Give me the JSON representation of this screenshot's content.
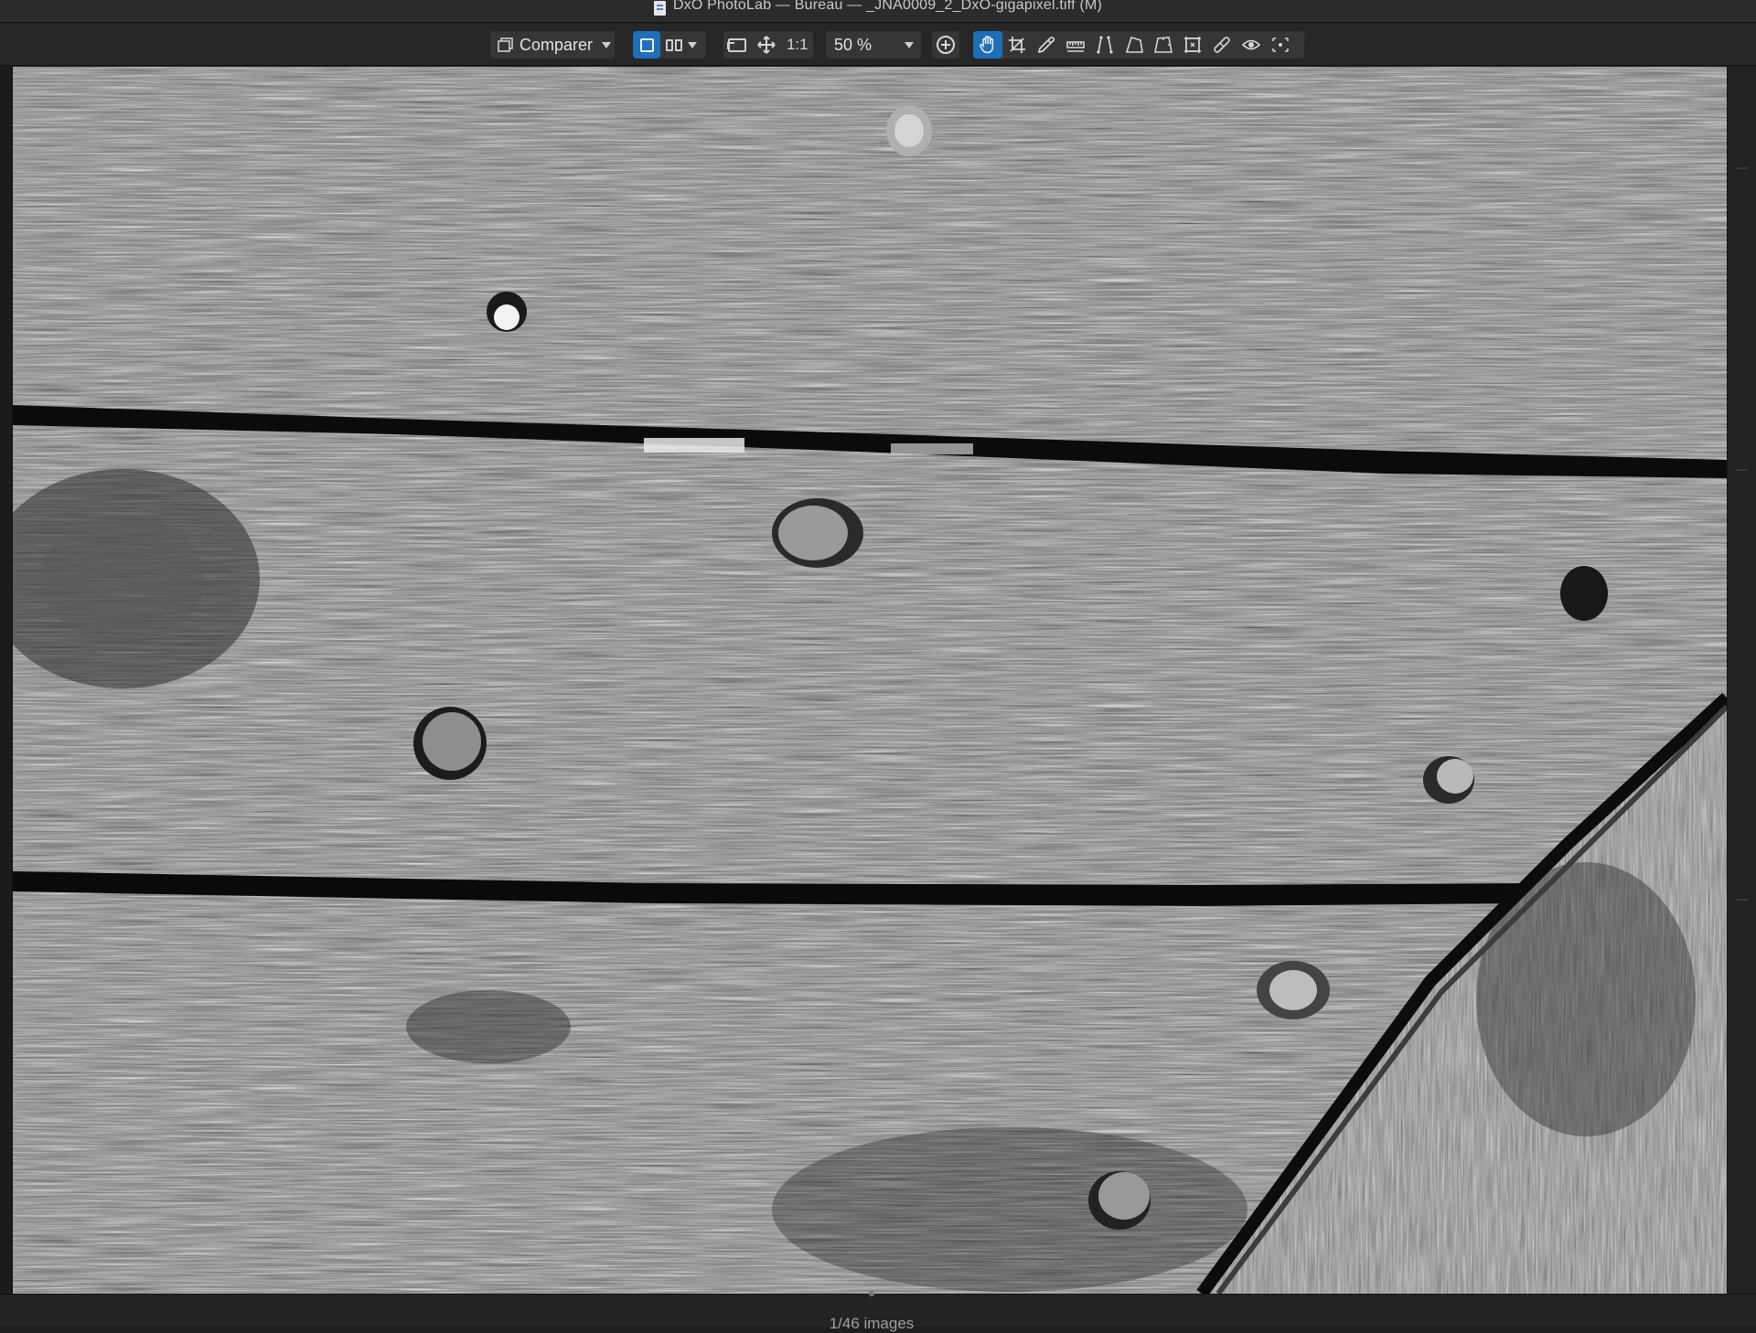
{
  "window": {
    "title": "DxO PhotoLab — Bureau — _JNA0009_2_DxO-gigapixel.tiff (M)"
  },
  "toolbar": {
    "compare_label": "Comparer",
    "one_to_one_label": "1:1",
    "zoom_value": "50 %",
    "tools": [
      {
        "name": "hand-tool",
        "active": true
      },
      {
        "name": "crop-tool",
        "active": false
      },
      {
        "name": "white-balance-picker",
        "active": false
      },
      {
        "name": "horizon-tool",
        "active": false
      },
      {
        "name": "perspective-vertical-tool",
        "active": false
      },
      {
        "name": "perspective-rect-tool",
        "active": false
      },
      {
        "name": "perspective-8point-tool",
        "active": false
      },
      {
        "name": "grid-tool",
        "active": false
      },
      {
        "name": "repair-tool",
        "active": false
      },
      {
        "name": "red-eye-tool",
        "active": false
      },
      {
        "name": "local-adjustments-tool",
        "active": false
      }
    ],
    "accent_color": "#1d6fb8"
  },
  "viewer": {
    "image_description_icon": "photo-canvas"
  },
  "status": {
    "image_count": "1/46 images"
  }
}
